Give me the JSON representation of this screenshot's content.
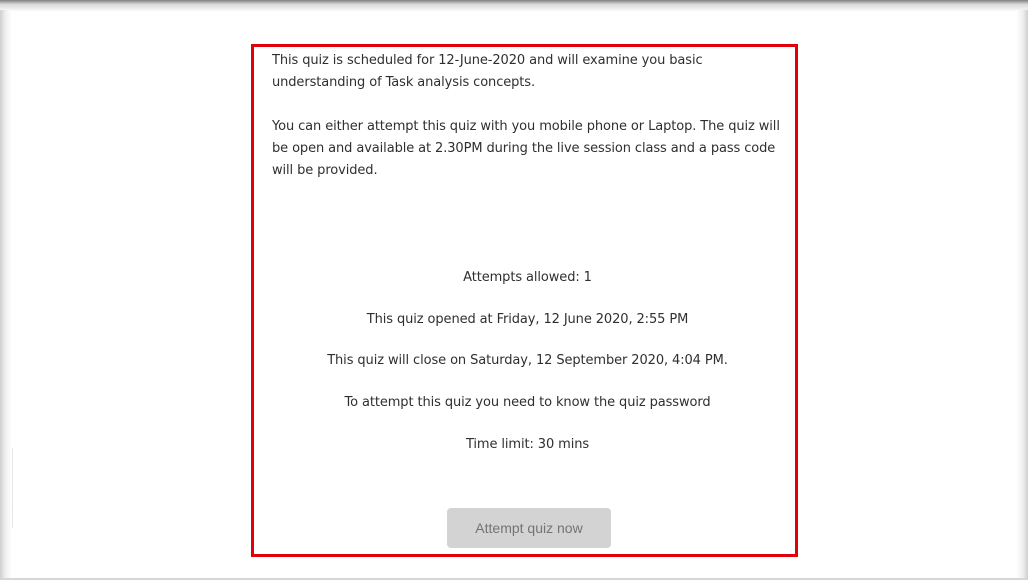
{
  "quiz": {
    "description": {
      "paragraph_1": "This quiz is scheduled for 12-June-2020 and will examine you basic understanding of Task analysis concepts.",
      "paragraph_2": "You can either attempt this quiz with you mobile phone or Laptop. The quiz will be open  and available at 2.30PM during the live session class and a pass code will be provided."
    },
    "details": {
      "attempts_allowed": "Attempts allowed: 1",
      "opened": "This quiz opened at Friday, 12 June 2020, 2:55 PM",
      "closes": "This quiz will close on Saturday, 12 September 2020, 4:04 PM.",
      "password_notice": "To attempt this quiz you need to know the quiz password",
      "time_limit": "Time limit: 30 mins"
    },
    "attempt_button_label": "Attempt quiz now"
  },
  "colors": {
    "highlight_border": "#e3000b",
    "button_background": "#d3d3d3",
    "button_text": "#747474"
  }
}
